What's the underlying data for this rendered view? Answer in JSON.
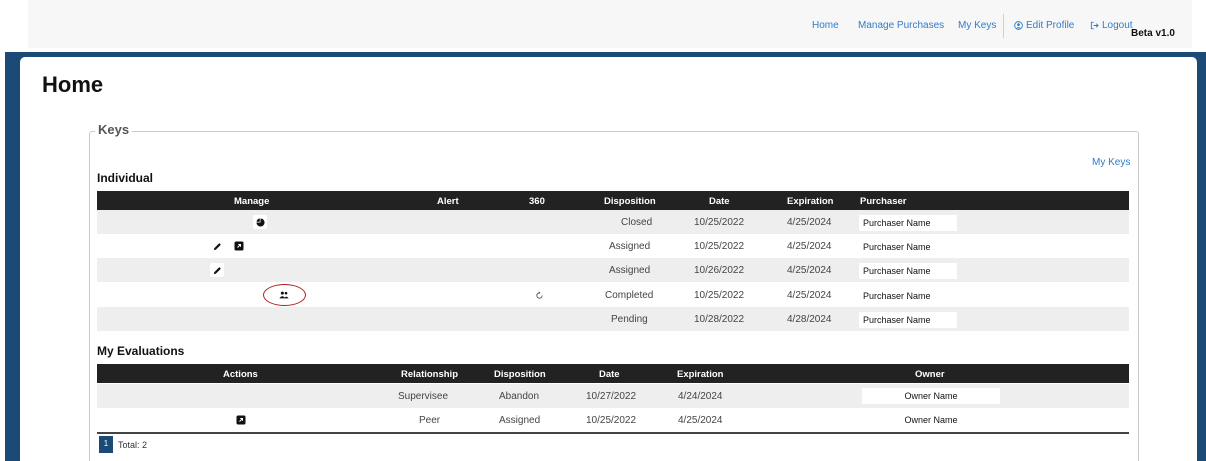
{
  "nav": {
    "home": "Home",
    "manage_purchases": "Manage Purchases",
    "my_keys": "My Keys",
    "edit_profile": "Edit Profile",
    "logout": "Logout",
    "version": "Beta v1.0",
    "icons": {
      "edit_profile": "user-circle-icon",
      "logout": "logout-arrow-icon"
    }
  },
  "page": {
    "title": "Home"
  },
  "keys": {
    "legend": "Keys",
    "my_keys_link": "My Keys",
    "individual": {
      "title": "Individual",
      "columns": [
        "Manage",
        "Alert",
        "360",
        "Disposition",
        "Date",
        "Expiration",
        "Purchaser"
      ],
      "rows": [
        {
          "manage_icons": [
            "pie-chart-icon"
          ],
          "alert": "",
          "three_sixty": "",
          "disposition": "Closed",
          "date": "10/25/2022",
          "expiration": "4/25/2024",
          "purchaser": "Purchaser Name"
        },
        {
          "manage_icons": [
            "pencil-icon",
            "open-box-icon"
          ],
          "alert": "",
          "three_sixty": "",
          "disposition": "Assigned",
          "date": "10/25/2022",
          "expiration": "4/25/2024",
          "purchaser": "Purchaser Name"
        },
        {
          "manage_icons": [
            "pencil-icon"
          ],
          "alert": "",
          "three_sixty": "",
          "disposition": "Assigned",
          "date": "10/26/2022",
          "expiration": "4/25/2024",
          "purchaser": "Purchaser Name"
        },
        {
          "manage_icons": [
            "users-icon"
          ],
          "alert": "",
          "three_sixty": "refresh-icon",
          "disposition": "Completed",
          "date": "10/25/2022",
          "expiration": "4/25/2024",
          "purchaser": "Purchaser Name"
        },
        {
          "manage_icons": [],
          "alert": "",
          "three_sixty": "",
          "disposition": "Pending",
          "date": "10/28/2022",
          "expiration": "4/28/2024",
          "purchaser": "Purchaser Name"
        }
      ]
    }
  },
  "evaluations": {
    "title": "My Evaluations",
    "columns": [
      "Actions",
      "Relationship",
      "Disposition",
      "Date",
      "Expiration",
      "Owner"
    ],
    "rows": [
      {
        "action_icons": [],
        "relationship": "Supervisee",
        "disposition": "Abandon",
        "date": "10/27/2022",
        "expiration": "4/24/2024",
        "owner": "Owner Name"
      },
      {
        "action_icons": [
          "open-box-icon"
        ],
        "relationship": "Peer",
        "disposition": "Assigned",
        "date": "10/25/2022",
        "expiration": "4/25/2024",
        "owner": "Owner Name"
      }
    ],
    "pager": {
      "current_page": "1",
      "total_label": "Total: 2"
    }
  },
  "colors": {
    "frame": "#1c4a77",
    "link": "#2f7cc9",
    "table_header": "#222222",
    "annotation_circle": "#b01e1e"
  }
}
